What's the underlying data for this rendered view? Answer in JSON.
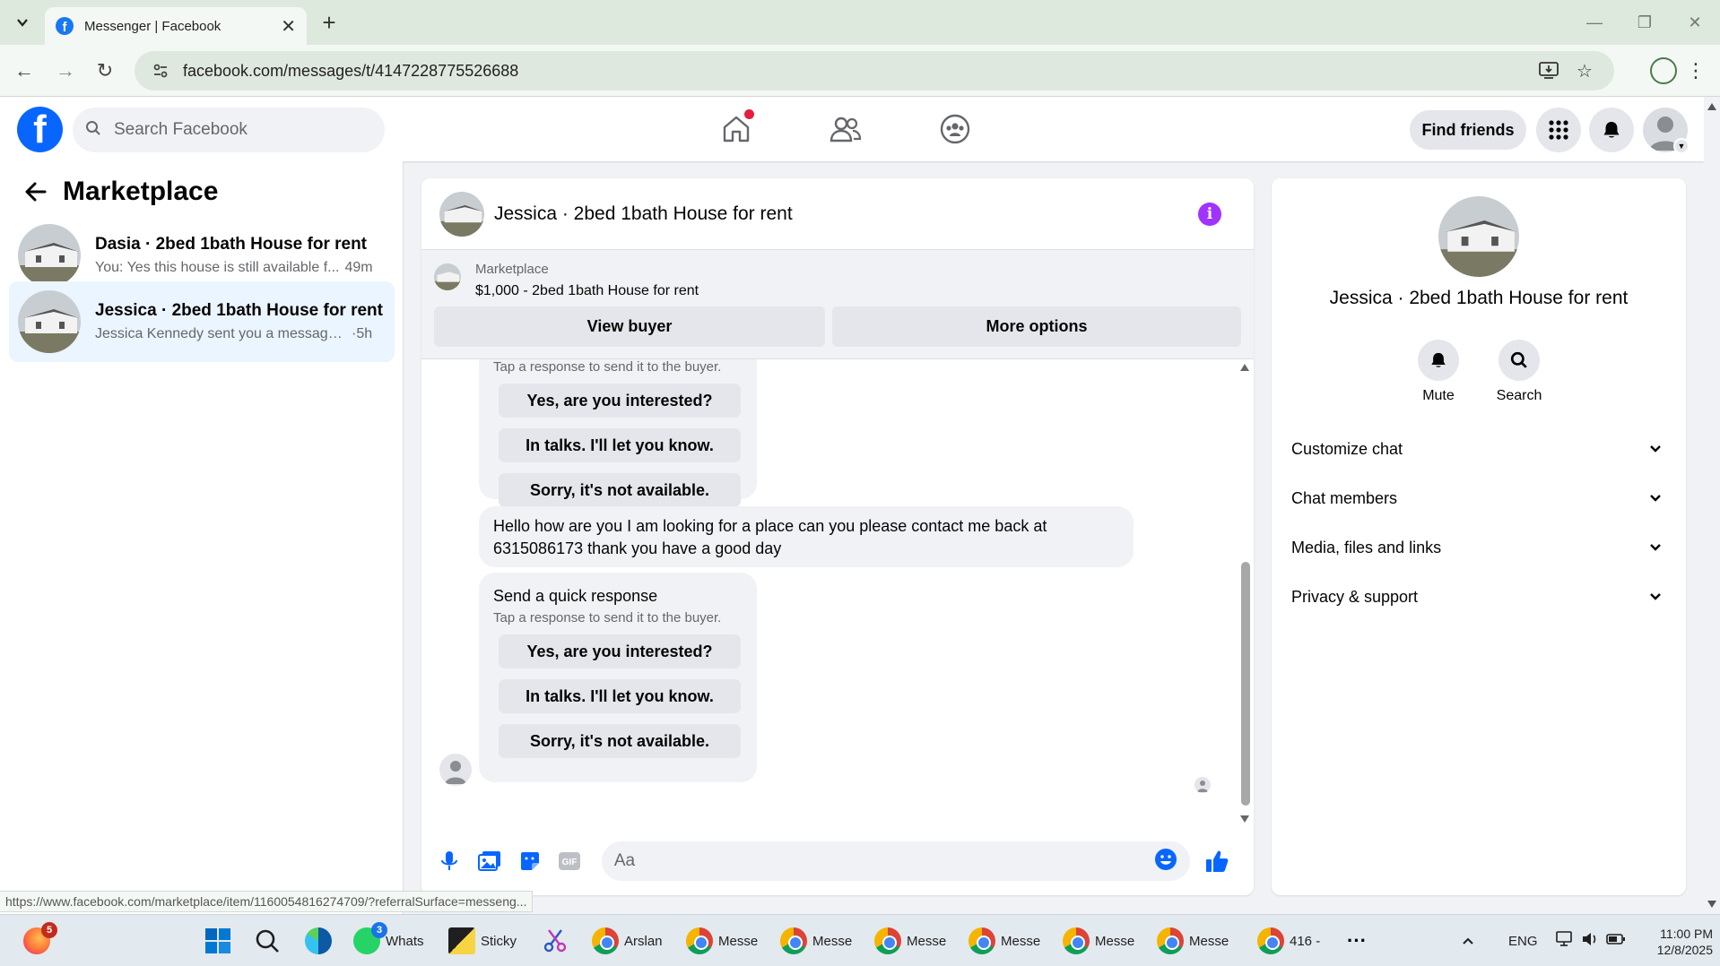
{
  "browser": {
    "tab_title": "Messenger | Facebook",
    "url": "facebook.com/messages/t/4147228775526688",
    "status_url": "https://www.facebook.com/marketplace/item/1160054816274709/?referralSurface=messeng..."
  },
  "header": {
    "search_placeholder": "Search Facebook",
    "find_friends": "Find friends",
    "colors": {
      "brand": "#0866ff",
      "notification_dot": "#e41e3f"
    }
  },
  "sidebar": {
    "title": "Marketplace",
    "conversations": [
      {
        "name": "Dasia · 2bed 1bath House for rent",
        "preview": "You: Yes this house is still available f...",
        "time": "49m",
        "active": false
      },
      {
        "name": "Jessica · 2bed 1bath House for rent",
        "preview": "Jessica Kennedy sent you a message a...",
        "time": "·5h",
        "active": true
      }
    ]
  },
  "chat": {
    "title": "Jessica · 2bed 1bath House for rent",
    "marketplace_label": "Marketplace",
    "listing": "$1,000 - 2bed 1bath House for rent",
    "view_buyer": "View buyer",
    "more_options": "More options",
    "quick_response_title": "Send a quick response",
    "quick_response_sub": "Tap a response to send it to the buyer.",
    "quick_replies": [
      "Yes, are you interested?",
      "In talks. I'll let you know.",
      "Sorry, it's not available."
    ],
    "message_line1": "Hello how are you I am looking for a place can you please contact me back at",
    "message_line2": "6315086173 thank you have a good day",
    "composer_placeholder": "Aa",
    "accent": "#a033ff"
  },
  "info_panel": {
    "name": "Jessica · 2bed 1bath House for rent",
    "mute": "Mute",
    "search": "Search",
    "sections": [
      "Customize chat",
      "Chat members",
      "Media, files and links",
      "Privacy & support"
    ]
  },
  "taskbar": {
    "firefox_badge": "5",
    "whatsapp_label": "Whats",
    "whatsapp_badge": "3",
    "sticky_label": "Sticky",
    "chrome_items": [
      "Arslan",
      "Messe",
      "Messe",
      "Messe",
      "Messe",
      "Messe",
      "Messe",
      "416 -"
    ],
    "more": "···",
    "lang": "ENG",
    "time": "11:00 PM",
    "date": "12/8/2025"
  }
}
